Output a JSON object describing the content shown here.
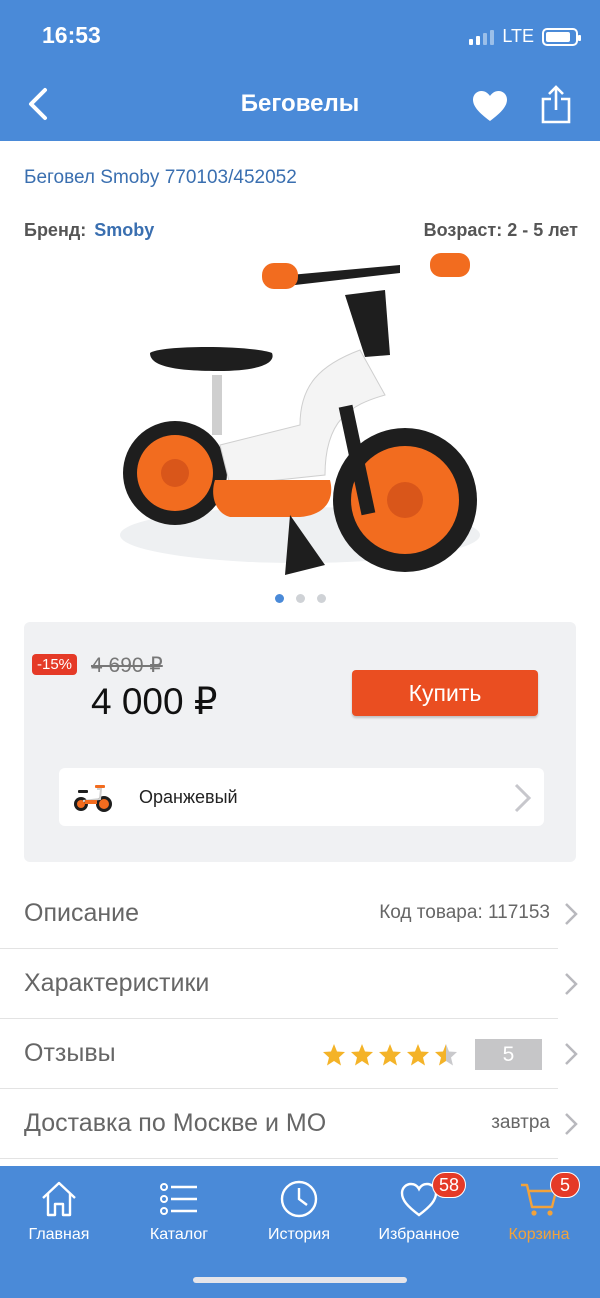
{
  "status_bar": {
    "time": "16:53",
    "network": "LTE",
    "battery_level": 0.85
  },
  "header": {
    "title": "Беговелы",
    "back_icon": "chevron-left-icon",
    "favorite_icon": "heart-icon",
    "share_icon": "share-icon"
  },
  "product": {
    "name": "Беговел Smoby 770103/452052",
    "brand_label": "Бренд:",
    "brand_value": "Smoby",
    "age_label": "Возраст: 2 - 5 лет",
    "image_count": 3,
    "active_image": 1
  },
  "price": {
    "discount": "-15%",
    "old_price": "4 690 ₽",
    "new_price": "4 000 ₽",
    "buy_label": "Купить"
  },
  "color_option": {
    "label": "Оранжевый"
  },
  "rows": {
    "description": {
      "label": "Описание",
      "value": "Код товара: 117153"
    },
    "specs": {
      "label": "Характеристики"
    },
    "reviews": {
      "label": "Отзывы",
      "rating": 4.5,
      "count": "5"
    },
    "delivery": {
      "label": "Доставка по Москве и МО",
      "value": "завтра"
    }
  },
  "tabbar": {
    "home": {
      "label": "Главная"
    },
    "catalog": {
      "label": "Каталог"
    },
    "history": {
      "label": "История"
    },
    "favorites": {
      "label": "Избранное",
      "badge": "58"
    },
    "cart": {
      "label": "Корзина",
      "badge": "5"
    }
  },
  "colors": {
    "primary": "#4a8ad8",
    "buy": "#ea4e21",
    "discount": "#e53a27",
    "active_tab": "#f2a23b",
    "star": "#f4b328"
  }
}
